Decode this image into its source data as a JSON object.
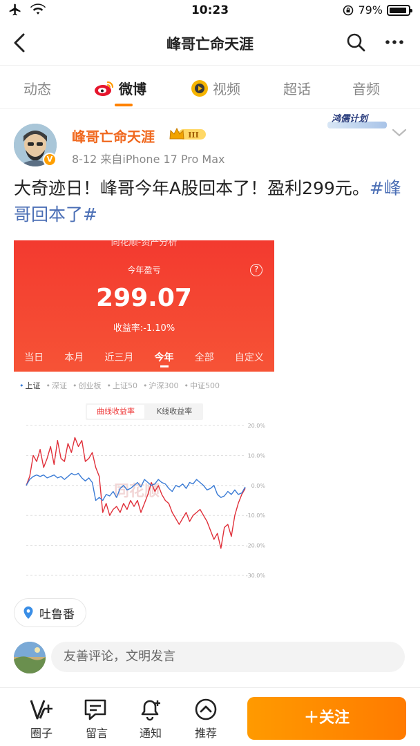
{
  "status_bar": {
    "time": "10:23",
    "battery": "79%",
    "battery_level": 0.79
  },
  "nav": {
    "title": "峰哥亡命天涯"
  },
  "tabs": [
    {
      "label": "动态",
      "active": false
    },
    {
      "label": "微博",
      "active": true
    },
    {
      "label": "视频",
      "active": false
    },
    {
      "label": "超话",
      "active": false
    },
    {
      "label": "音频",
      "active": false
    }
  ],
  "post": {
    "username": "峰哥亡命天涯",
    "level_badge": "III",
    "meta": "8-12  来自iPhone 17 Pro Max",
    "campaign_badge": "鸿儒计划",
    "text_main": "大奇迹日！峰哥今年A股回本了！盈利299元。",
    "hashtag": "#峰哥回本了#",
    "location": "吐鲁番"
  },
  "image": {
    "app_title": "同花顺-资产分析",
    "profit_label": "今年盈亏",
    "profit_value": "299.07",
    "rate_label": "收益率:-1.10%",
    "periods": [
      {
        "label": "当日",
        "active": false
      },
      {
        "label": "本月",
        "active": false
      },
      {
        "label": "近三月",
        "active": false
      },
      {
        "label": "今年",
        "active": true
      },
      {
        "label": "全部",
        "active": false
      },
      {
        "label": "自定义",
        "active": false
      }
    ],
    "indices": [
      {
        "label": "上证",
        "active": true
      },
      {
        "label": "深证",
        "active": false
      },
      {
        "label": "创业板",
        "active": false
      },
      {
        "label": "上证50",
        "active": false
      },
      {
        "label": "沪深300",
        "active": false
      },
      {
        "label": "中证500",
        "active": false
      }
    ],
    "toggle": [
      {
        "label": "曲线收益率",
        "active": true
      },
      {
        "label": "K线收益率",
        "active": false
      }
    ],
    "watermark": "同花顺"
  },
  "chart_data": {
    "type": "line",
    "yticks": [
      "20.0%",
      "10.0%",
      "0.0%",
      "-10.0%",
      "-20.0%",
      "-30.0%"
    ],
    "ylim": [
      -30,
      20
    ],
    "series": [
      {
        "color": "#e0303a",
        "values": [
          0,
          3,
          10,
          8,
          12,
          6,
          9,
          13,
          7,
          15,
          9,
          8,
          14,
          11,
          16,
          13,
          15,
          8,
          9,
          11,
          6,
          3,
          -9,
          -6,
          -10,
          -8,
          -7,
          -9,
          -6,
          -8,
          -5,
          -7,
          -5,
          -9,
          -6,
          -3,
          1,
          -2,
          0,
          -3,
          -5,
          -6,
          -9,
          -11,
          -13,
          -11,
          -9,
          -12,
          -10,
          -9,
          -8,
          -10,
          -12,
          -15,
          -18,
          -16,
          -21,
          -14,
          -13,
          -17,
          -10,
          -6,
          -3,
          -1
        ]
      },
      {
        "color": "#3a7bd5",
        "values": [
          0,
          2,
          3,
          3.5,
          3,
          3.5,
          2.5,
          3,
          3.5,
          2.5,
          3,
          2,
          3,
          4,
          3.5,
          4,
          2.5,
          1.5,
          2.5,
          1,
          -5,
          -4,
          -5,
          -3,
          -3.5,
          -2,
          -4,
          -1,
          0,
          -1.5,
          -1,
          0,
          1,
          -0.5,
          2,
          1,
          0,
          0.5,
          2,
          1,
          0.5,
          -1,
          -2,
          0,
          -0.5,
          0.5,
          -1,
          1,
          0.5,
          2,
          1,
          0,
          -1.5,
          -1,
          0,
          -3,
          -4,
          -3.5,
          -2,
          -3,
          -1.5,
          -3,
          -2.5,
          -0.5
        ]
      }
    ]
  },
  "comment": {
    "placeholder": "友善评论，文明发言"
  },
  "bottom_bar": {
    "items": [
      {
        "label": "圈子"
      },
      {
        "label": "留言"
      },
      {
        "label": "通知"
      },
      {
        "label": "推荐"
      }
    ],
    "follow_label": "＋关注"
  },
  "colors": {
    "accent": "#ff8200",
    "username": "#f0681e",
    "hashtag": "#4a6eb5",
    "header_red": "#f33a2f"
  }
}
